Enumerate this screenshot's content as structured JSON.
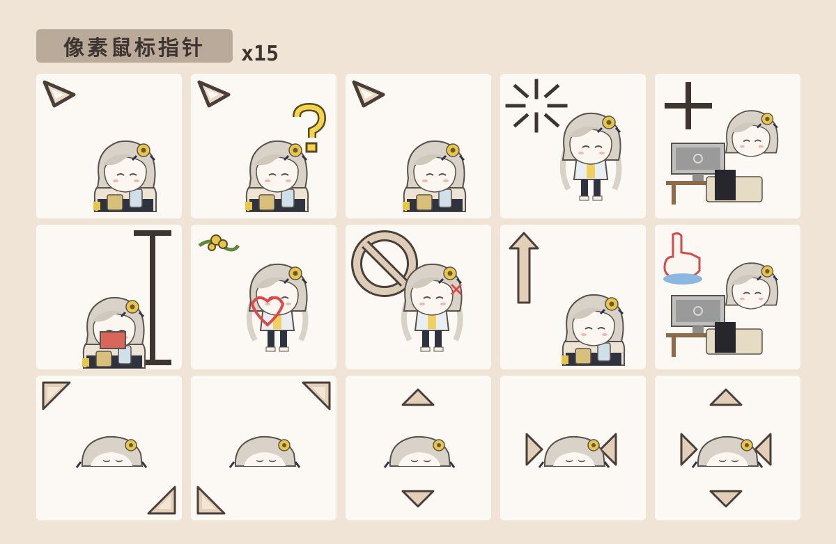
{
  "header": {
    "title": "像素鼠标指针",
    "count": "x15"
  },
  "tiles": [
    {
      "name": "normal-select",
      "cursor": "arrow-icon",
      "pose": "drinking"
    },
    {
      "name": "help-select",
      "cursor": "arrow-icon",
      "accent": "question-mark-icon",
      "pose": "drinking"
    },
    {
      "name": "working-in-background",
      "cursor": "arrow-icon",
      "pose": "drinking-surprised"
    },
    {
      "name": "busy",
      "cursor": "loading-burst-icon",
      "pose": "standing"
    },
    {
      "name": "precision-select",
      "cursor": "crosshair-icon",
      "pose": "computer"
    },
    {
      "name": "text-select",
      "cursor": "text-beam-icon",
      "pose": "reading"
    },
    {
      "name": "handwriting",
      "cursor": "flower-icon",
      "pose": "heart"
    },
    {
      "name": "unavailable",
      "cursor": "no-symbol-icon",
      "pose": "angry"
    },
    {
      "name": "alternate-select",
      "cursor": "up-arrow-icon",
      "pose": "crying"
    },
    {
      "name": "link-select",
      "cursor": "hand-pointer-icon",
      "pose": "computer"
    },
    {
      "name": "diagonal-resize-1",
      "cursor": "diagonal-arrows-icon",
      "pose": "sleeping"
    },
    {
      "name": "diagonal-resize-2",
      "cursor": "diagonal-arrows-icon",
      "pose": "sleeping"
    },
    {
      "name": "vertical-resize",
      "cursor": "vertical-arrows-icon",
      "pose": "sleeping"
    },
    {
      "name": "horizontal-resize",
      "cursor": "horizontal-arrows-icon",
      "pose": "sleeping"
    },
    {
      "name": "move",
      "cursor": "four-way-arrows-icon",
      "pose": "sleeping"
    }
  ],
  "colors": {
    "background": "#f0e4d6",
    "tile": "#fcf8f3",
    "tag": "#b9aa99",
    "ink": "#3e3530",
    "arrow": "#e3cfb8",
    "arrow_edge": "#4a3f38"
  }
}
